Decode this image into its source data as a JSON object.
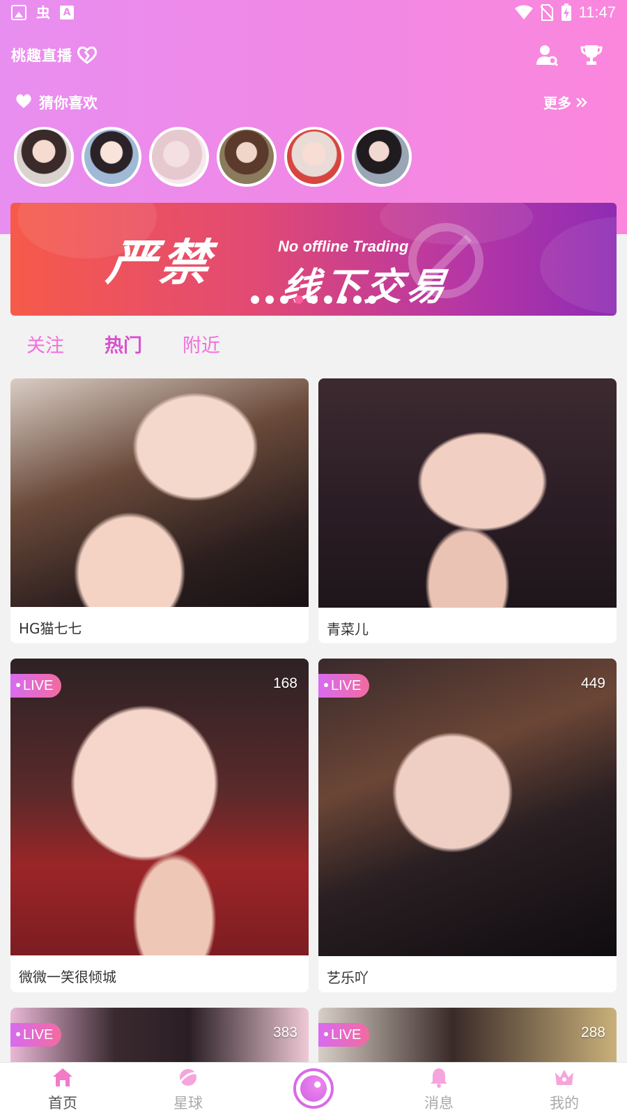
{
  "status_bar": {
    "left_icons": [
      "image-icon",
      "bug-icon",
      "a-icon"
    ],
    "bug_glyph": "虫",
    "a_glyph": "A",
    "time": "11:47"
  },
  "header": {
    "app_title": "桃趣直播",
    "guess_title": "猜你喜欢",
    "more_label": "更多"
  },
  "banner": {
    "big_text": "严禁",
    "small_text": "No offline Trading",
    "sub_text": "线下交易",
    "dot_count": 9,
    "active_dot": 3
  },
  "tabs": [
    {
      "label": "关注",
      "active": false
    },
    {
      "label": "热门",
      "active": true
    },
    {
      "label": "附近",
      "active": false
    }
  ],
  "cards": [
    {
      "name": "HG猫七七",
      "live": false,
      "viewers": ""
    },
    {
      "name": "青菜儿",
      "live": false,
      "viewers": ""
    },
    {
      "name": "微微一笑很倾城",
      "live": true,
      "live_label": "LIVE",
      "viewers": "168"
    },
    {
      "name": "艺乐吖",
      "live": true,
      "live_label": "LIVE",
      "viewers": "449"
    },
    {
      "name": "",
      "live": true,
      "live_label": "LIVE",
      "viewers": "383"
    },
    {
      "name": "",
      "live": true,
      "live_label": "LIVE",
      "viewers": "288"
    }
  ],
  "bottom_nav": [
    {
      "label": "首页",
      "icon": "home-icon",
      "active": true
    },
    {
      "label": "星球",
      "icon": "planet-icon",
      "active": false
    },
    {
      "label": "",
      "icon": "live-camera-icon",
      "active": false
    },
    {
      "label": "消息",
      "icon": "bell-icon",
      "active": false
    },
    {
      "label": "我的",
      "icon": "crown-icon",
      "active": false
    }
  ],
  "colors": {
    "header_gradient_start": "#e88ef0",
    "header_gradient_end": "#fb87dc",
    "tab_active": "#d94fd0",
    "tab_inactive": "#f26fdc",
    "live_badge": "#d86bf0",
    "nav_active": "#f27ac8"
  }
}
